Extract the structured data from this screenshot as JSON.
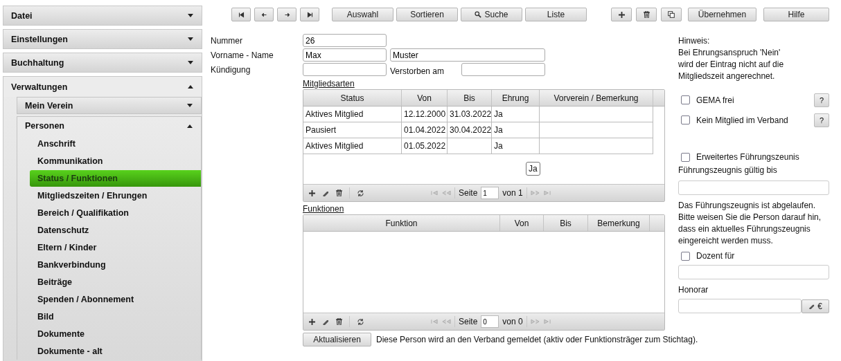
{
  "sidebar": {
    "sections": [
      {
        "label": "Datei",
        "expanded": false
      },
      {
        "label": "Einstellungen",
        "expanded": false
      },
      {
        "label": "Buchhaltung",
        "expanded": false
      },
      {
        "label": "Verwaltungen",
        "expanded": true,
        "children": [
          {
            "label": "Mein Verein",
            "expanded": false
          },
          {
            "label": "Personen",
            "expanded": true,
            "items": [
              {
                "label": "Anschrift",
                "selected": false
              },
              {
                "label": "Kommunikation",
                "selected": false
              },
              {
                "label": "Status / Funktionen",
                "selected": true
              },
              {
                "label": "Mitgliedszeiten / Ehrungen",
                "selected": false
              },
              {
                "label": "Bereich / Qualifikation",
                "selected": false
              },
              {
                "label": "Datenschutz",
                "selected": false
              },
              {
                "label": "Eltern / Kinder",
                "selected": false
              },
              {
                "label": "Bankverbindung",
                "selected": false
              },
              {
                "label": "Beiträge",
                "selected": false
              },
              {
                "label": "Spenden / Abonnement",
                "selected": false
              },
              {
                "label": "Bild",
                "selected": false
              },
              {
                "label": "Dokumente",
                "selected": false
              },
              {
                "label": "Dokumente - alt",
                "selected": false
              }
            ]
          }
        ]
      }
    ]
  },
  "toolbar": {
    "nav_buttons": [
      {
        "kind": "first"
      },
      {
        "kind": "prev"
      },
      {
        "kind": "next"
      },
      {
        "kind": "last"
      }
    ],
    "buttons": [
      {
        "label": "Auswahl"
      },
      {
        "label": "Sortieren"
      },
      {
        "label": "Suche",
        "kind": "search"
      },
      {
        "label": "Liste"
      }
    ],
    "action_buttons": [
      {
        "kind": "add"
      },
      {
        "kind": "delete"
      },
      {
        "kind": "copy"
      }
    ],
    "end_buttons": [
      "Übernehmen",
      "Hilfe"
    ]
  },
  "form": {
    "number": {
      "label": "Nummer",
      "value": "26"
    },
    "name": {
      "label": "Vorname - Name",
      "first": "Max",
      "last": "Muster"
    },
    "termination": {
      "label": "Kündigung",
      "deceased_label": "Verstorben am"
    }
  },
  "memberships": {
    "title": "Mitgliedsarten",
    "columns": [
      "Status",
      "Von",
      "Bis",
      "Ehrung",
      "Vorverein / Bemerkung"
    ],
    "rows": [
      {
        "status": "Aktives Mitglied",
        "from": "12.12.2000",
        "to": "31.03.2022",
        "honor": "Ja"
      },
      {
        "status": "Pausiert",
        "from": "01.04.2022",
        "to": "30.04.2022",
        "honor": "Ja"
      },
      {
        "status": "Aktives Mitglied",
        "from": "01.05.2022",
        "honor": "Ja"
      }
    ],
    "tooltip": "Ja",
    "pager": {
      "page_label": "Seite",
      "page": "1",
      "of": "von 1"
    }
  },
  "functions": {
    "title": "Funktionen",
    "columns": [
      "Funktion",
      "Von",
      "Bis",
      "Bemerkung"
    ],
    "pager": {
      "page_label": "Seite",
      "page": "0",
      "of": "von 0"
    }
  },
  "footer": {
    "button": "Aktualisieren",
    "note": "Diese Person wird an den Verband gemeldet (aktiv oder Funktionsträger zum Stichtag)."
  },
  "side": {
    "hint": "Hinweis:\nBei Ehrungsanspruch 'Nein'\nwird der Eintrag nicht auf die\nMitgliedszeit angerechnet.",
    "checks": [
      {
        "label": "GEMA frei",
        "checked": false,
        "help": "?"
      },
      {
        "label": "Kein Mitglied im Verband",
        "checked": false,
        "help": "?"
      }
    ],
    "extended": {
      "label": "Erweitertes Führungszeunis",
      "checked": false
    },
    "valid_label": "Führungszeugnis gültig bis",
    "notice": "Das Führungszeugnis ist abgelaufen.\nBitte weisen Sie die Person darauf hin,\ndass ein aktuelles Führungszeugnis\neingereicht werden muss.",
    "lecturer": {
      "label": "Dozent für",
      "checked": false
    },
    "fee_label": "Honorar",
    "currency": "€"
  }
}
